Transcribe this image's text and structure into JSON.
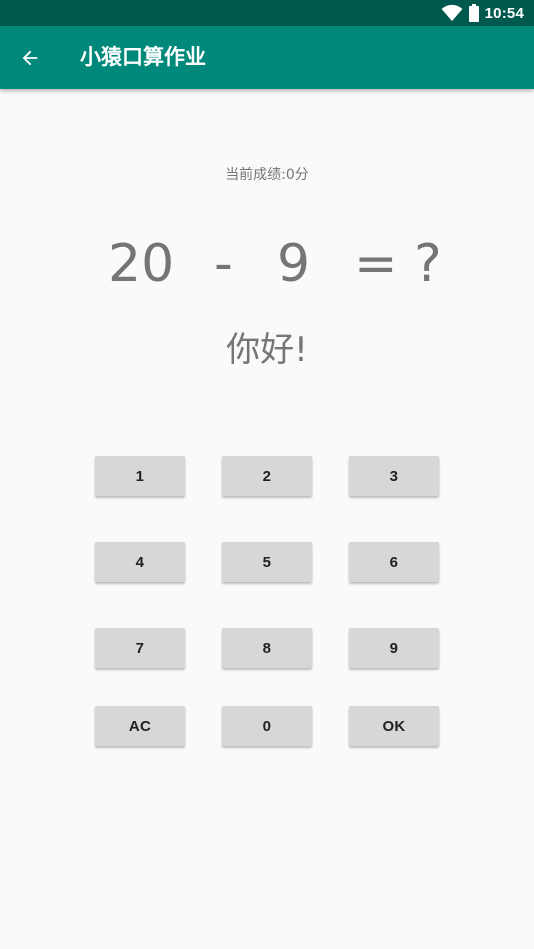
{
  "status_bar": {
    "time": "10:54",
    "icons": [
      "wifi-icon",
      "battery-icon"
    ],
    "background": "#00594f"
  },
  "app_bar": {
    "title": "小猿口算作业",
    "back_icon": "arrow-back-icon",
    "background": "#00897b"
  },
  "score": {
    "text": "当前成绩:0分"
  },
  "equation": {
    "left_operand": "20",
    "operator": "-",
    "right_operand": "9",
    "equals_question": "= ?"
  },
  "greeting": "你好!",
  "keypad": {
    "key_1": "1",
    "key_2": "2",
    "key_3": "3",
    "key_4": "4",
    "key_5": "5",
    "key_6": "6",
    "key_7": "7",
    "key_8": "8",
    "key_9": "9",
    "key_clear": "AC",
    "key_0": "0",
    "key_ok": "OK"
  },
  "colors": {
    "accent": "#00897b",
    "status_bar": "#00594f",
    "text_secondary": "#757575",
    "button_bg": "#d6d7d7"
  }
}
